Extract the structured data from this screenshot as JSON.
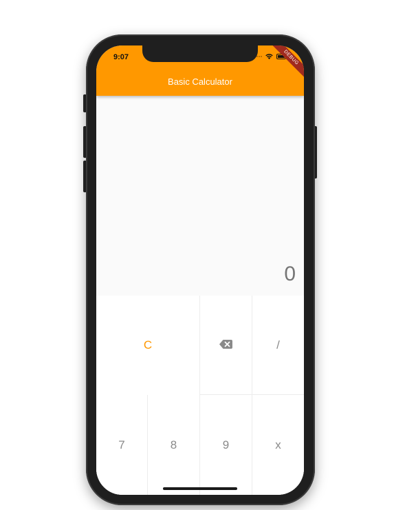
{
  "status_bar": {
    "time": "9:07"
  },
  "app_bar": {
    "title": "Basic Calculator",
    "color": "#ff9800"
  },
  "debug_banner": {
    "label": "DEBUG"
  },
  "display": {
    "value": "0"
  },
  "keypad": {
    "row1": {
      "clear_label": "C",
      "backspace_icon": "backspace-icon",
      "divide_label": "/"
    },
    "row2": {
      "seven_label": "7",
      "eight_label": "8",
      "nine_label": "9",
      "multiply_label": "x"
    },
    "accent_color": "#ff9800",
    "digit_color": "#8a8a8a"
  }
}
